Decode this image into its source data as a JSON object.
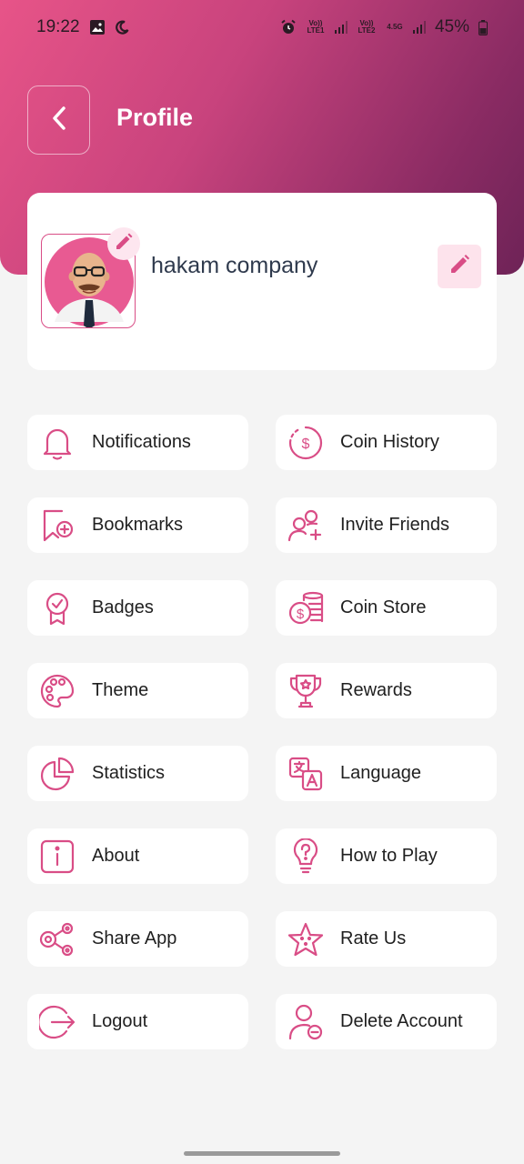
{
  "status_bar": {
    "time": "19:22",
    "sim1": "Vo)) LTE1",
    "sim2": "Vo)) LTE2",
    "network": "4.5G",
    "battery": "45%"
  },
  "header": {
    "title": "Profile"
  },
  "profile": {
    "name": "hakam company"
  },
  "menu": [
    {
      "label": "Notifications",
      "icon": "bell-icon"
    },
    {
      "label": "Coin History",
      "icon": "coin-history-icon"
    },
    {
      "label": "Bookmarks",
      "icon": "bookmark-icon"
    },
    {
      "label": "Invite Friends",
      "icon": "invite-friends-icon"
    },
    {
      "label": "Badges",
      "icon": "badge-icon"
    },
    {
      "label": "Coin Store",
      "icon": "coin-store-icon"
    },
    {
      "label": "Theme",
      "icon": "palette-icon"
    },
    {
      "label": "Rewards",
      "icon": "trophy-icon"
    },
    {
      "label": "Statistics",
      "icon": "pie-chart-icon"
    },
    {
      "label": "Language",
      "icon": "translate-icon"
    },
    {
      "label": "About",
      "icon": "info-icon"
    },
    {
      "label": "How to Play",
      "icon": "lightbulb-question-icon"
    },
    {
      "label": "Share App",
      "icon": "share-icon"
    },
    {
      "label": "Rate Us",
      "icon": "star-icon"
    },
    {
      "label": "Logout",
      "icon": "logout-icon"
    },
    {
      "label": "Delete Account",
      "icon": "delete-user-icon"
    }
  ],
  "colors": {
    "accent": "#d94d86",
    "header_start": "#e75488",
    "header_end": "#6e2357"
  }
}
